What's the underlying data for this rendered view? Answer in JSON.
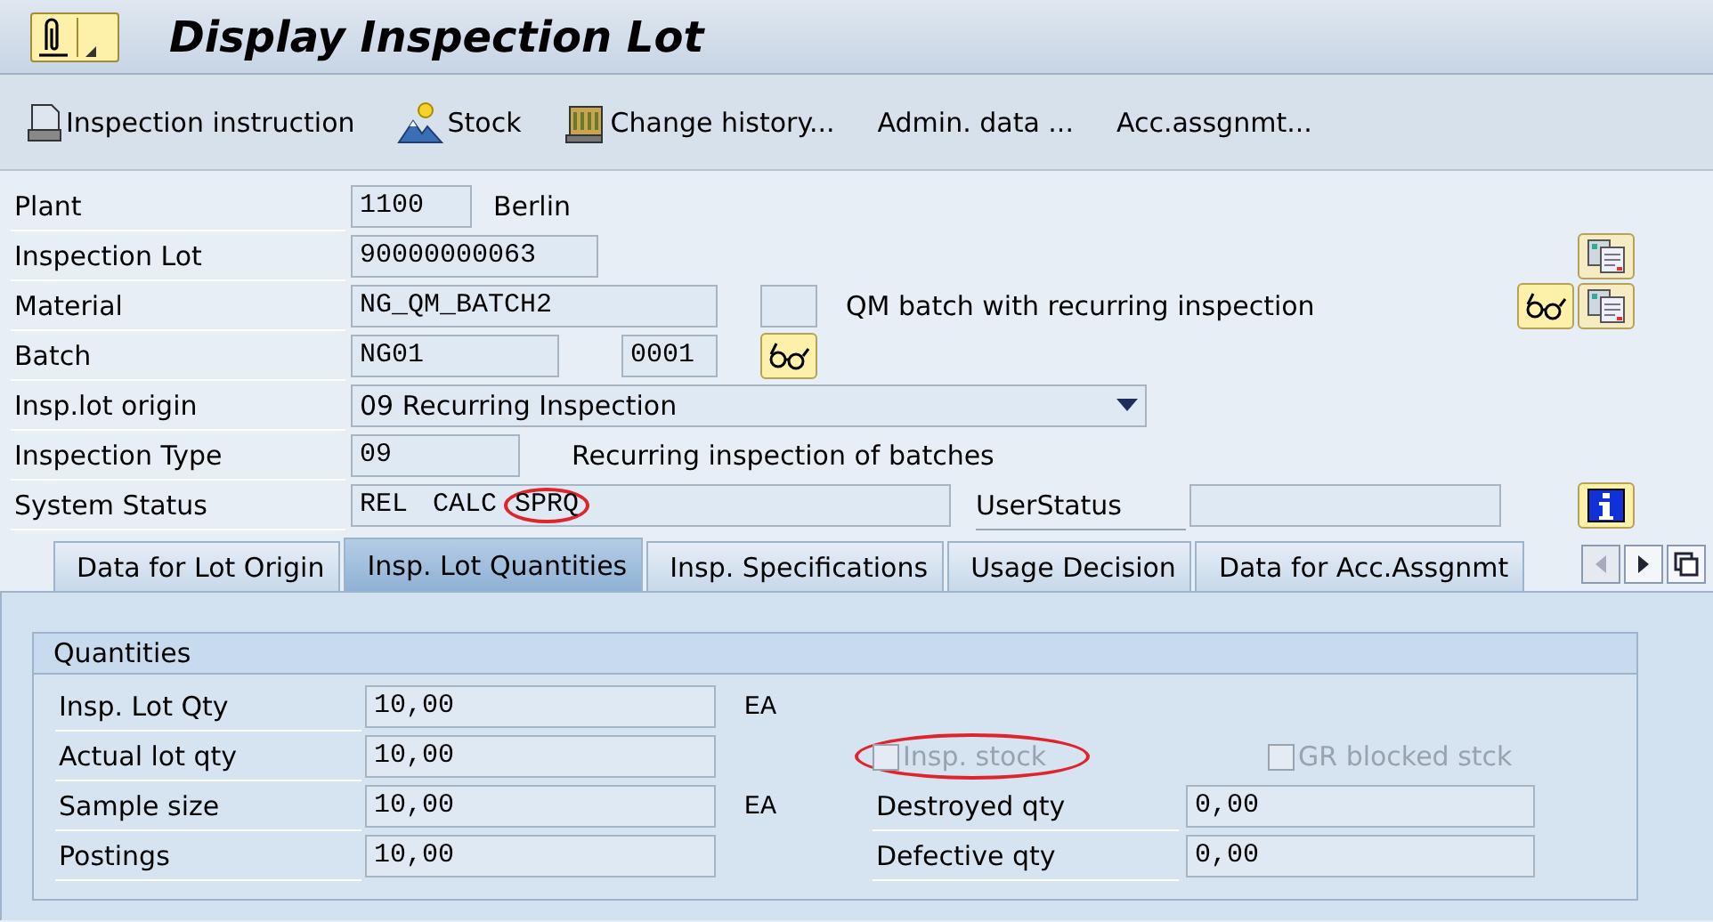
{
  "window": {
    "title": "Display Inspection Lot"
  },
  "toolbar": [
    {
      "label": "Inspection instruction",
      "kind": "printer"
    },
    {
      "label": "Stock",
      "kind": "mountain"
    },
    {
      "label": "Change history...",
      "kind": "scroll"
    },
    {
      "label": "Admin. data ...",
      "kind": "text"
    },
    {
      "label": "Acc.assgnmt...",
      "kind": "text"
    }
  ],
  "header": {
    "plant": {
      "label": "Plant",
      "value": "1100",
      "text": "Berlin"
    },
    "inspection_lot": {
      "label": "Inspection Lot",
      "value": "90000000063"
    },
    "material": {
      "label": "Material",
      "value": "NG_QM_BATCH2",
      "text": "QM batch with recurring inspection"
    },
    "batch": {
      "label": "Batch",
      "value": "NG01",
      "value_2": "0001"
    },
    "origin": {
      "label": "Insp.lot origin",
      "value": "09 Recurring Inspection"
    },
    "inspection_type": {
      "label": "Inspection Type",
      "value": "09",
      "text": "Recurring inspection of batches"
    },
    "system_status": {
      "label": "System Status",
      "codes": [
        {
          "code": "REL",
          "highlighted": false
        },
        {
          "code": "CALC",
          "highlighted": false
        },
        {
          "code": "SPRQ",
          "highlighted": true
        }
      ]
    },
    "user_status": {
      "label": "UserStatus"
    }
  },
  "tabs": [
    {
      "label": "Data for Lot Origin",
      "selected": false
    },
    {
      "label": "Insp. Lot Quantities",
      "selected": true
    },
    {
      "label": "Insp. Specifications",
      "selected": false
    },
    {
      "label": "Usage Decision",
      "selected": false
    },
    {
      "label": "Data for Acc.Assgnmt",
      "selected": false
    }
  ],
  "tab_nav": [
    {
      "kind": "left",
      "disabled": true
    },
    {
      "kind": "right",
      "disabled": false
    },
    {
      "kind": "list",
      "disabled": false
    }
  ],
  "quantities": {
    "title": "Quantities",
    "rows": [
      {
        "label": "Insp. Lot Qty",
        "value": "10,00",
        "unit": "EA",
        "right": []
      },
      {
        "label": "Actual lot qty",
        "value": "10,00",
        "right": [
          {
            "kind": "checkbox",
            "label": "Insp. stock",
            "checked": false,
            "disabled": true,
            "highlighted": true
          },
          {
            "kind": "checkbox",
            "label": "GR blocked stck",
            "checked": false,
            "disabled": true,
            "highlighted": false
          }
        ]
      },
      {
        "label": "Sample size",
        "value": "10,00",
        "unit": "EA",
        "right": [
          {
            "kind": "field",
            "label": "Destroyed qty",
            "value": "0,00"
          }
        ]
      },
      {
        "label": "Postings",
        "value": "10,00",
        "right": [
          {
            "kind": "field",
            "label": "Defective qty",
            "value": "0,00"
          }
        ]
      }
    ]
  }
}
